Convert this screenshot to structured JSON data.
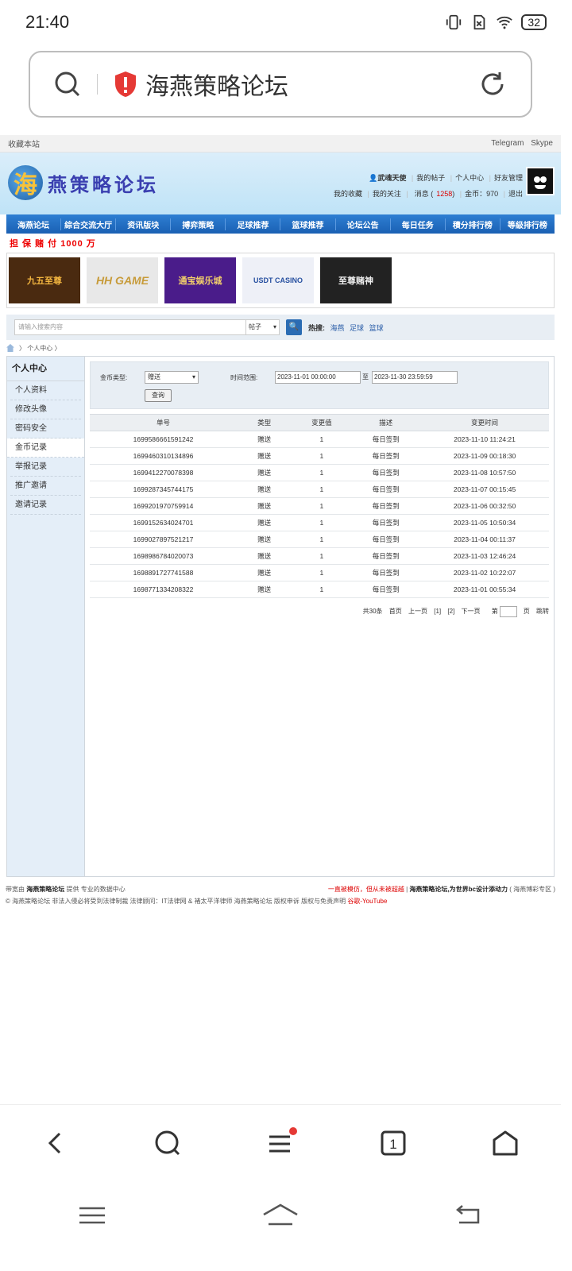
{
  "status": {
    "time": "21:40",
    "battery": "32"
  },
  "browser": {
    "site_title": "海燕策略论坛"
  },
  "topbar": {
    "left": "收藏本站",
    "telegram": "Telegram",
    "skype": "Skype"
  },
  "header": {
    "logo_text": "燕策略论坛",
    "logo_mark": "海",
    "username": "武魂天使",
    "links1": [
      "我的帖子",
      "个人中心",
      "好友管理"
    ],
    "my_fav": "我的收藏",
    "my_follow": "我的关注",
    "msg_label": "消息",
    "msg_count": "1258",
    "coin_label": "金币：970",
    "logout": "退出"
  },
  "nav": [
    "海燕论坛",
    "綜合交流大厅",
    "资讯版块",
    "搏弈策略",
    "足球推荐",
    "篮球推荐",
    "论坛公告",
    "每日任务",
    "積分排行榜",
    "等級排行榜"
  ],
  "promo": "担 保 赌 付 1000 万",
  "ads": [
    {
      "text": "九五至尊",
      "icon": "crown-badge-icon"
    },
    {
      "text": "HH GAME",
      "icon": "hh-game-logo"
    },
    {
      "text": "通宝娱乐城",
      "icon": "casino-chip-icon"
    },
    {
      "text": "USDT CASINO",
      "icon": "usdt-casino-logo"
    },
    {
      "text": "至尊赌神",
      "icon": "dice-banner-icon"
    }
  ],
  "search": {
    "placeholder": "请输入搜索内容",
    "type": "帖子",
    "hot_label": "热搜:",
    "hot": [
      "海燕",
      "足球",
      "篮球"
    ]
  },
  "breadcrumb": {
    "current": "个人中心"
  },
  "sidebar": {
    "title": "个人中心",
    "items": [
      "个人资料",
      "修改头像",
      "密码安全",
      "金币记录",
      "举报记录",
      "推广邀请",
      "邀请记录"
    ],
    "active": "金币记录"
  },
  "filter": {
    "coin_type_label": "金币类型:",
    "coin_type_value": "赠送",
    "range_label": "时间范围:",
    "start": "2023-11-01 00:00:00",
    "to": "至",
    "end": "2023-11-30 23:59:59",
    "query": "查询"
  },
  "table": {
    "headers": [
      "单号",
      "类型",
      "变更值",
      "描述",
      "变更时间"
    ],
    "rows": [
      [
        "1699586661591242",
        "赠送",
        "1",
        "每日签到",
        "2023-11-10 11:24:21"
      ],
      [
        "1699460310134896",
        "赠送",
        "1",
        "每日签到",
        "2023-11-09 00:18:30"
      ],
      [
        "1699412270078398",
        "赠送",
        "1",
        "每日签到",
        "2023-11-08 10:57:50"
      ],
      [
        "1699287345744175",
        "赠送",
        "1",
        "每日签到",
        "2023-11-07 00:15:45"
      ],
      [
        "1699201970759914",
        "赠送",
        "1",
        "每日签到",
        "2023-11-06 00:32:50"
      ],
      [
        "1699152634024701",
        "赠送",
        "1",
        "每日签到",
        "2023-11-05 10:50:34"
      ],
      [
        "1699027897521217",
        "赠送",
        "1",
        "每日签到",
        "2023-11-04 00:11:37"
      ],
      [
        "1698986784020073",
        "赠送",
        "1",
        "每日签到",
        "2023-11-03 12:46:24"
      ],
      [
        "1698891727741588",
        "赠送",
        "1",
        "每日签到",
        "2023-11-02 10:22:07"
      ],
      [
        "1698771334208322",
        "赠送",
        "1",
        "每日签到",
        "2023-11-01 00:55:34"
      ]
    ]
  },
  "pager": {
    "total": "共30条",
    "first": "首页",
    "prev": "上一页",
    "p1": "[1]",
    "p2": "[2]",
    "next": "下一页",
    "goto_pre": "第",
    "goto_post": "页",
    "jump": "跳转"
  },
  "footer": {
    "line1_pre": "带宽由",
    "line1_brand": "海燕策略论坛",
    "line1_post": "提供 专业的数据中心",
    "line1_red": "一直被模仿，但从未被超越",
    "line1_right_bold": "海燕策略论坛,为世界bc设计添动力",
    "line1_right_tail": "( 海燕博彩专区 )",
    "line2": "© 海燕策略论坛 非法入侵必将受到法律制裁 法律顾问：IT法律网 & 褚太平洋律师  海燕策略论坛  版权申诉  版权与免责声明",
    "line2_red": "谷歌-YouTube"
  },
  "bottom_tabs": {
    "count": "1"
  }
}
